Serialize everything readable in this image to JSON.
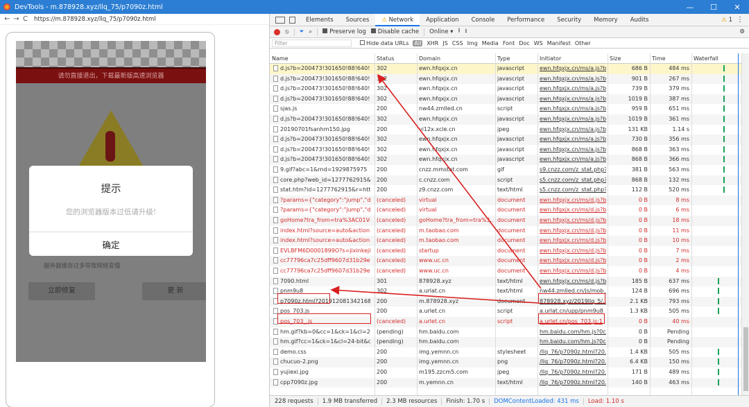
{
  "window": {
    "title": "DevTools - m.878928.xyz/llq_75/p7090z.html",
    "controls": [
      "—",
      "☐",
      "✕"
    ]
  },
  "browser": {
    "url": "https://m.878928.xyz/llq_75/p7090z.html"
  },
  "phone": {
    "banner": "请勿直接退出，下载最新版高速浏览器",
    "dialog_title": "提示",
    "dialog_message": "您的浏览器版本过低请升级!",
    "dialog_button": "确定",
    "cache_note": "服务器缓存过多导致网络变慢",
    "btn_repair": "立即修复",
    "btn_update": "更 新"
  },
  "devtools": {
    "tabs": [
      "Elements",
      "Sources",
      "Network",
      "Application",
      "Console",
      "Performance",
      "Security",
      "Memory",
      "Audits"
    ],
    "active_tab": "Network",
    "warning_count": "1",
    "toolbar": {
      "preserve_log": "Preserve log",
      "disable_cache": "Disable cache",
      "throttle": "Online"
    },
    "filter": {
      "placeholder": "Filter",
      "hide_data_urls": "Hide data URLs",
      "types": [
        "All",
        "XHR",
        "JS",
        "CSS",
        "Img",
        "Media",
        "Font",
        "Doc",
        "WS",
        "Manifest",
        "Other"
      ]
    },
    "columns": [
      "Name",
      "Status",
      "Domain",
      "Type",
      "Initiator",
      "Size",
      "Time",
      "Waterfall"
    ],
    "rows": [
      [
        "d.js?b=200473!301650!88!640!15...",
        "302",
        "ewn.hfqxjx.cn",
        "javascript",
        "ewn.hfqxjx.cn/ms/a.js?b...",
        "686 B",
        "484 ms"
      ],
      [
        "d.js?b=200473!301650!88!640!15...",
        "302",
        "ewn.hfqxjx.cn",
        "javascript",
        "ewn.hfqxjx.cn/ms/a.js?b...",
        "901 B",
        "267 ms"
      ],
      [
        "d.js?b=200473!301650!88!640!15...",
        "302",
        "ewn.hfqxjx.cn",
        "javascript",
        "ewn.hfqxjx.cn/ms/a.js?b...",
        "739 B",
        "379 ms"
      ],
      [
        "d.js?b=200473!301650!88!640!15...",
        "302",
        "ewn.hfqxjx.cn",
        "javascript",
        "ewn.hfqxjx.cn/ms/a.js?b...",
        "1019 B",
        "387 ms"
      ],
      [
        "sjas.js",
        "200",
        "nw44.zmlled.cn",
        "script",
        "ewn.hfqxjx.cn/ms/a.js?b...",
        "959 B",
        "651 ms"
      ],
      [
        "d.js?b=200473!301650!88!640!15...",
        "302",
        "ewn.hfqxjx.cn",
        "javascript",
        "ewn.hfqxjx.cn/ms/a.js?b...",
        "1019 B",
        "361 ms"
      ],
      [
        "20190701fsanhm150.jpg",
        "200",
        "vi12x.xcle.cn",
        "jpeg",
        "ewn.hfqxjx.cn/ms/a.js?b...",
        "131 KB",
        "1.14 s"
      ],
      [
        "d.js?b=200473!301650!88!640!15...",
        "302",
        "ewn.hfqxjx.cn",
        "javascript",
        "ewn.hfqxjx.cn/ms/a.js?b...",
        "730 B",
        "356 ms"
      ],
      [
        "d.js?b=200473!301650!88!640!15...",
        "302",
        "ewn.hfqxjx.cn",
        "javascript",
        "ewn.hfqxjx.cn/ms/a.js?b...",
        "868 B",
        "363 ms"
      ],
      [
        "d.js?b=200473!301650!88!640!15...",
        "302",
        "ewn.hfqxjx.cn",
        "javascript",
        "ewn.hfqxjx.cn/ms/a.js?b...",
        "868 B",
        "366 ms"
      ],
      [
        "9.gif?abc=1&rnd=1929875975",
        "200",
        "cnzz.mmstat.com",
        "gif",
        "s9.cnzz.com/z_stat.php?...",
        "381 B",
        "563 ms"
      ],
      [
        "core.php?web_id=1277762915&t...",
        "200",
        "c.cnzz.com",
        "script",
        "s5.cnzz.com/z_stat.php?...",
        "868 B",
        "132 ms"
      ],
      [
        "stat.htm?id=1277762915&r=http...",
        "200",
        "z9.cnzz.com",
        "text/html",
        "s5.cnzz.com/z_stat.php?...",
        "112 B",
        "520 ms"
      ],
      [
        "?params={\"category\":\"jump\",\"des...",
        "(canceled)",
        "virtual",
        "document",
        "ewn.hfqxjx.cn/ms/d.js?b...",
        "0 B",
        "8 ms"
      ],
      [
        "?params={\"category\":\"jump\",\"des...",
        "(canceled)",
        "virtual",
        "document",
        "ewn.hfqxjx.cn/ms/d.js?b...",
        "0 B",
        "6 ms"
      ],
      [
        "goHome?tra_from=tra%3AC01V4...",
        "(canceled)",
        "goHome?tra_from=tra%3...",
        "document",
        "ewn.hfqxjx.cn/ms/d.js?b...",
        "0 B",
        "18 ms"
      ],
      [
        "index.html?source=auto&action=...",
        "(canceled)",
        "m.taobao.com",
        "document",
        "ewn.hfqxjx.cn/ms/d.js?b...",
        "0 B",
        "11 ms"
      ],
      [
        "index.html?source=auto&action=...",
        "(canceled)",
        "m.taobao.com",
        "document",
        "ewn.hfqxjx.cn/ms/d.js?b...",
        "0 B",
        "10 ms"
      ],
      [
        "EVLBFM6D0001899O?s=jixinkeji...",
        "(canceled)",
        "startup",
        "document",
        "ewn.hfqxjx.cn/ms/d.js?b...",
        "0 B",
        "7 ms"
      ],
      [
        "cc77796ca7c25dff9607d31b29eff...",
        "(canceled)",
        "www.uc.cn",
        "document",
        "ewn.hfqxjx.cn/ms/d.js?b...",
        "0 B",
        "2 ms"
      ],
      [
        "cc77796ca7c25dff9607d31b29eff...",
        "(canceled)",
        "www.uc.cn",
        "document",
        "ewn.hfqxjx.cn/ms/d.js?b...",
        "0 B",
        "4 ms"
      ],
      [
        "7090.html",
        "301",
        "878928.xyz",
        "text/html",
        "ewn.hfqxjx.cn/ms/d.js?b...",
        "185 B",
        "637 ms"
      ],
      [
        "pnm9u8",
        "302",
        "a.urlat.cn",
        "text/html",
        "nw44.zmlled.cn/js/mob...",
        "124 B",
        "696 ms"
      ],
      [
        "p7090z.html?201912081342168t...",
        "200",
        "m.878928.xyz",
        "document",
        "878928.xyz/2019llq_5/...",
        "2.1 KB",
        "793 ms"
      ],
      [
        "pos_703.js",
        "200",
        "a.urlet.cn",
        "script",
        "a.urlat.cn/upp/pnm9u8",
        "1.3 KB",
        "505 ms"
      ],
      [
        "pos_703_.js",
        "(canceled)",
        "a.urlet.cn",
        "script",
        "a.urlet.cn/pos_703.js:1",
        "0 B",
        "40 ms"
      ],
      [
        "hm.gif?kb=0&cc=1&ck=1&cl=24...",
        "(pending)",
        "hm.baidu.com",
        "",
        "hm.baidu.com/hm.js?0c...",
        "0 B",
        "Pending"
      ],
      [
        "hm.gif?cc=1&ck=1&cl=24-bit&d...",
        "(pending)",
        "hm.baidu.com",
        "",
        "hm.baidu.com/hm.js?0c...",
        "0 B",
        "Pending"
      ],
      [
        "demo.css",
        "200",
        "img.yemnn.cn",
        "stylesheet",
        "/llq_76/p7090z.html?20...",
        "1.4 KB",
        "505 ms"
      ],
      [
        "chucuo-2.png",
        "200",
        "img.yemnn.cn",
        "png",
        "/llq_76/p7090z.html?20...",
        "6.4 KB",
        "150 ms"
      ],
      [
        "yujiexi.jpg",
        "200",
        "m195.zzcm5.com",
        "jpeg",
        "/llq_76/p7090z.html?20...",
        "171 B",
        "489 ms"
      ],
      [
        "cpp7090z.jpg",
        "200",
        "m.yemnn.cn",
        "text/html",
        "/llq_76/p7090z.html?20...",
        "140 B",
        "463 ms"
      ]
    ],
    "status": {
      "requests": "228 requests",
      "transferred": "1.9 MB transferred",
      "resources": "2.3 MB resources",
      "finish": "Finish: 1.70 s",
      "dcl": "DOMContentLoaded: 431 ms",
      "load": "Load: 1.10 s"
    }
  },
  "colors": {
    "accent": "#1a73e8",
    "canceled": "#d32a2a",
    "highlight_box": "#d92020"
  }
}
